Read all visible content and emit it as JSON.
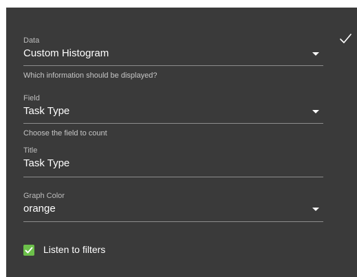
{
  "fields": {
    "data": {
      "label": "Data",
      "value": "Custom Histogram",
      "hint": "Which information should be displayed?"
    },
    "field": {
      "label": "Field",
      "value": "Task Type",
      "hint": "Choose the field to count"
    },
    "title": {
      "label": "Title",
      "value": "Task Type"
    },
    "graph_color": {
      "label": "Graph Color",
      "value": "orange"
    }
  },
  "listen_filters": {
    "label": "Listen to filters",
    "checked": true
  },
  "icons": {
    "confirm": "checkmark-icon",
    "dropdown": "caret-down-icon",
    "checkbox": "checkbox-checked-icon"
  },
  "colors": {
    "panel_bg": "#3a3a3a",
    "checkbox": "#6cc04a"
  }
}
